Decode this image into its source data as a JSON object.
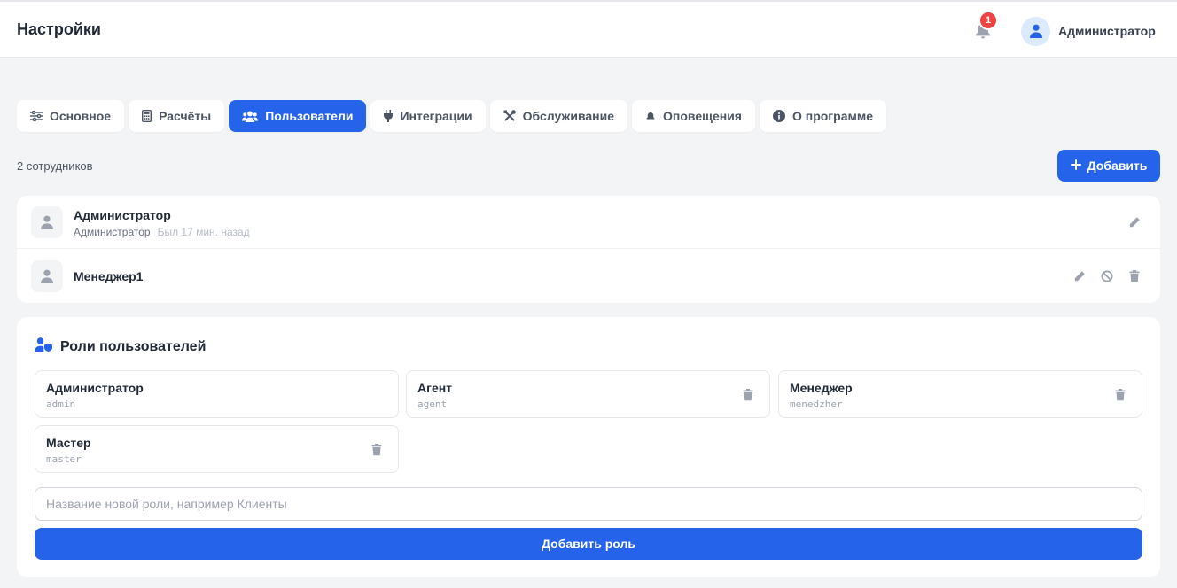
{
  "header": {
    "title": "Настройки",
    "notification_count": "1",
    "user_name": "Администратор"
  },
  "tabs": [
    {
      "label": "Основное",
      "icon": "sliders-icon",
      "active": false
    },
    {
      "label": "Расчёты",
      "icon": "calculator-icon",
      "active": false
    },
    {
      "label": "Пользователи",
      "icon": "users-icon",
      "active": true
    },
    {
      "label": "Интеграции",
      "icon": "plug-icon",
      "active": false
    },
    {
      "label": "Обслуживание",
      "icon": "tools-icon",
      "active": false
    },
    {
      "label": "Оповещения",
      "icon": "bell-icon",
      "active": false
    },
    {
      "label": "О программе",
      "icon": "info-icon",
      "active": false
    }
  ],
  "employees": {
    "count_text": "2 сотрудников",
    "add_label": "Добавить",
    "items": [
      {
        "name": "Администратор",
        "role": "Администратор",
        "last_seen": "Был 17 мин. назад"
      },
      {
        "name": "Менеджер1"
      }
    ]
  },
  "roles": {
    "title": "Роли пользователей",
    "items": [
      {
        "label": "Администратор",
        "code": "admin"
      },
      {
        "label": "Агент",
        "code": "agent"
      },
      {
        "label": "Менеджер",
        "code": "menedzher"
      },
      {
        "label": "Мастер",
        "code": "master"
      }
    ],
    "input_placeholder": "Название новой роли, например Клиенты",
    "input_value": "",
    "add_label": "Добавить роль"
  },
  "colors": {
    "accent": "#2563eb",
    "badge": "#ef4444",
    "background": "#f3f4f6"
  }
}
